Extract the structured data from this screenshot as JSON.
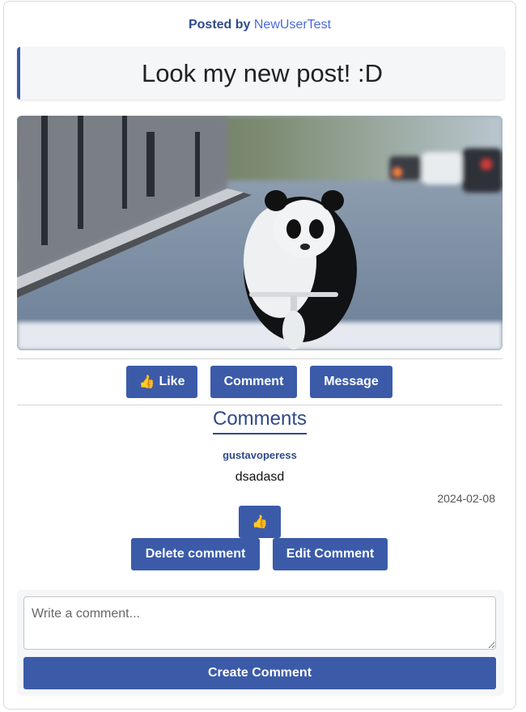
{
  "post": {
    "posted_by_prefix": "Posted by ",
    "author": "NewUserTest",
    "title": "Look my new post! :D"
  },
  "actions": {
    "like_icon": "👍",
    "like_label": "Like",
    "comment_label": "Comment",
    "message_label": "Message"
  },
  "comments": {
    "heading": "Comments",
    "items": [
      {
        "user": "gustavoperess",
        "text": "dsadasd",
        "date": "2024-02-08",
        "like_icon": "👍",
        "delete_label": "Delete comment",
        "edit_label": "Edit Comment"
      }
    ]
  },
  "composer": {
    "placeholder": "Write a comment...",
    "submit_label": "Create Comment"
  },
  "colors": {
    "primary": "#3b5ba9",
    "heading": "#2f4a8a",
    "author_link": "#4a6ad8"
  }
}
